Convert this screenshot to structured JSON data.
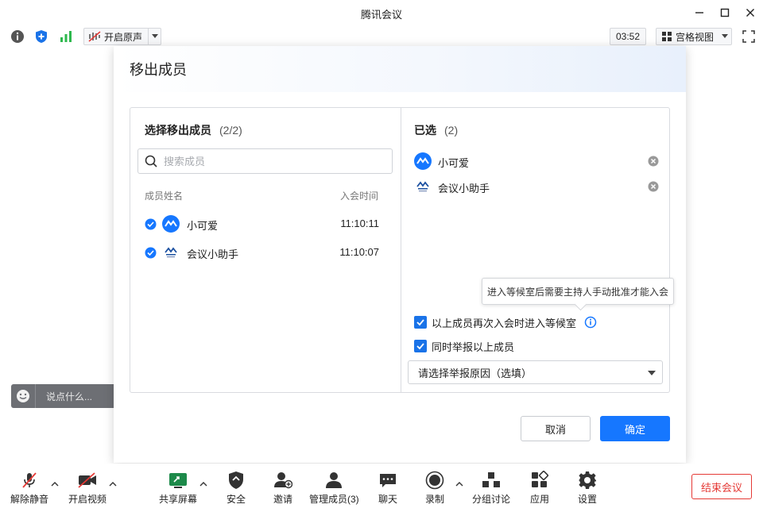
{
  "window": {
    "title": "腾讯会议"
  },
  "topbar": {
    "original_sound": "开启原声",
    "timer": "03:52",
    "view_mode": "宫格视图"
  },
  "chat": {
    "placeholder": "说点什么..."
  },
  "modal": {
    "title": "移出成员",
    "left": {
      "title": "选择移出成员",
      "count": "(2/2)",
      "search_placeholder": "搜索成员",
      "col_name": "成员姓名",
      "col_time": "入会时间",
      "members": [
        {
          "name": "小可爱",
          "time": "11:10:11"
        },
        {
          "name": "会议小助手",
          "time": "11:10:07"
        }
      ]
    },
    "right": {
      "title": "已选",
      "count": "(2)",
      "selected": [
        {
          "name": "小可爱"
        },
        {
          "name": "会议小助手"
        }
      ],
      "tooltip": "进入等候室后需要主持人手动批准才能入会",
      "option_waiting_room": "以上成员再次入会时进入等候室",
      "option_report": "同时举报以上成员",
      "report_select": "请选择举报原因（选填）"
    },
    "cancel_label": "取消",
    "confirm_label": "确定"
  },
  "bottombar": {
    "unmute": "解除静音",
    "video": "开启视频",
    "share": "共享屏幕",
    "security": "安全",
    "invite": "邀请",
    "members": "管理成员(3)",
    "chat": "聊天",
    "record": "录制",
    "breakout": "分组讨论",
    "apps": "应用",
    "settings": "设置",
    "end": "结束会议"
  },
  "colors": {
    "accent": "#1677ff",
    "danger": "#e53935",
    "signal": "#2db84d"
  }
}
